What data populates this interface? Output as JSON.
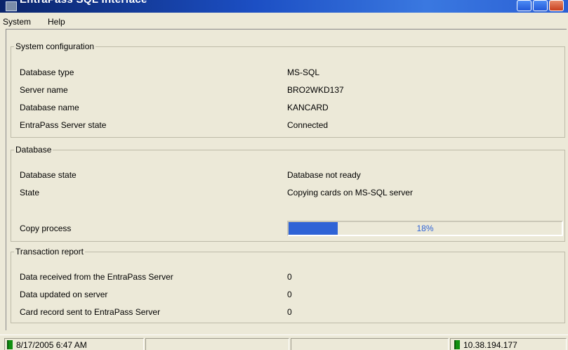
{
  "window": {
    "title": "EntraPass SQL Interface"
  },
  "menu": {
    "items": [
      "System",
      "Help"
    ]
  },
  "system_configuration": {
    "legend": "System configuration",
    "rows": [
      {
        "label": "Database type",
        "value": "MS-SQL"
      },
      {
        "label": "Server name",
        "value": "BRO2WKD137"
      },
      {
        "label": "Database name",
        "value": "KANCARD"
      },
      {
        "label": "EntraPass Server state",
        "value": "Connected"
      }
    ]
  },
  "database": {
    "legend": "Database",
    "rows": [
      {
        "label": "Database state",
        "value": "Database not ready"
      },
      {
        "label": "State",
        "value": "Copying cards on MS-SQL server"
      }
    ],
    "copy_process": {
      "label": "Copy process",
      "percent": 18,
      "percent_text": "18%"
    }
  },
  "transaction_report": {
    "legend": "Transaction report",
    "rows": [
      {
        "label": "Data received from the EntraPass Server",
        "value": "0"
      },
      {
        "label": "Data updated on server",
        "value": "0"
      },
      {
        "label": "Card record sent to EntraPass Server",
        "value": "0"
      }
    ]
  },
  "statusbar": {
    "datetime": "8/17/2005 6:47 AM",
    "ip": "10.38.194.177"
  },
  "colors": {
    "progress": "#2f63d6",
    "led": "#109010",
    "titlebar": "#0a246a"
  }
}
